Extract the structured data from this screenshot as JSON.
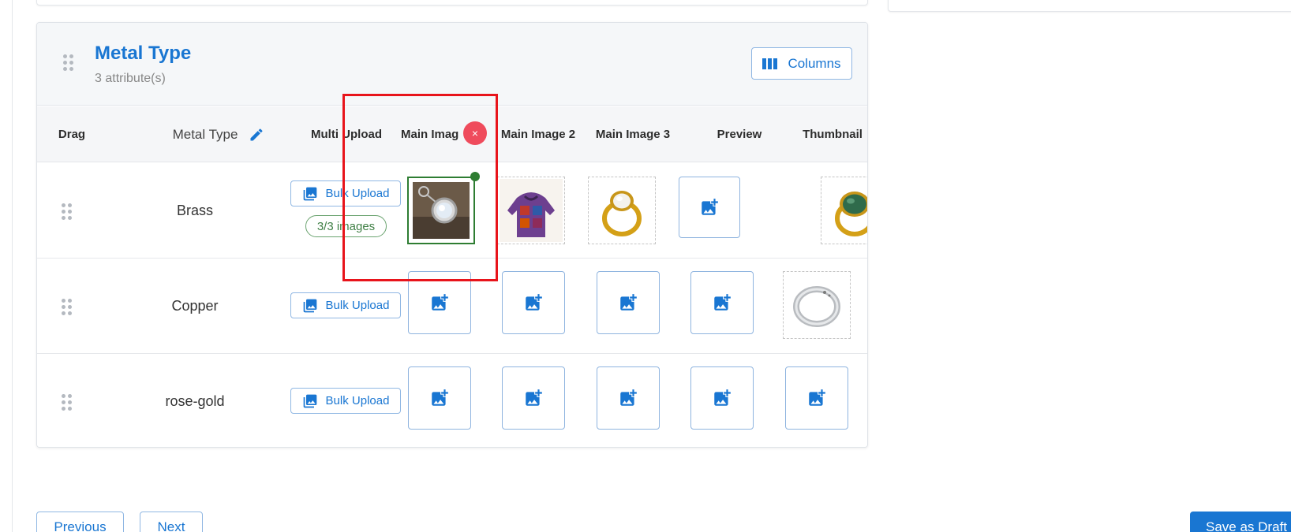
{
  "section": {
    "title": "Metal Type",
    "subtitle": "3 attribute(s)",
    "columns_label": "Columns"
  },
  "table": {
    "headers": {
      "drag": "Drag",
      "metal_type": "Metal Type",
      "multi_upload": "Multi Upload",
      "main_image": "Main Imag",
      "main_image_2": "Main Image 2",
      "main_image_3": "Main Image 3",
      "preview": "Preview",
      "thumbnail": "Thumbnail"
    },
    "rows": [
      {
        "name": "Brass",
        "bulk_label": "Bulk Upload",
        "image_count": "3/3 images"
      },
      {
        "name": "Copper",
        "bulk_label": "Bulk Upload"
      },
      {
        "name": "rose-gold",
        "bulk_label": "Bulk Upload"
      }
    ]
  },
  "remove_label": "×",
  "footer": {
    "previous_label": "Previous",
    "next_label": "Next",
    "save_draft_label": "Save as Draft"
  },
  "colors": {
    "accent": "#1976d2",
    "success": "#2e7d32",
    "danger": "#ef4b5c",
    "highlight": "#e8141b"
  }
}
